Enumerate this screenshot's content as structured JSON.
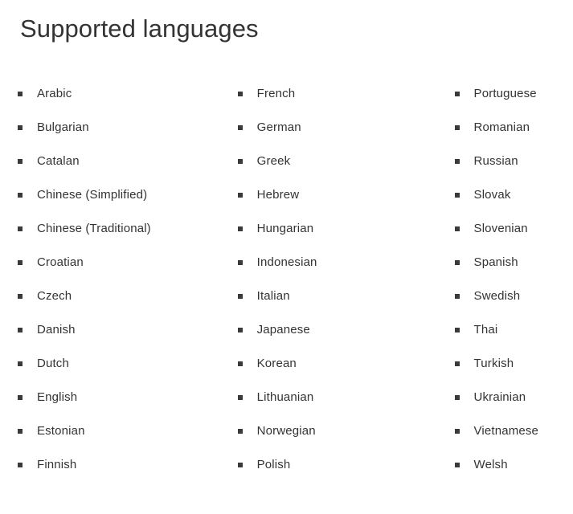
{
  "page": {
    "title": "Supported languages",
    "background_color": "#ffffff",
    "text_color": "#333333",
    "bullet_color": "#3a3a3a",
    "bullet_icon": "square-bullet-icon"
  },
  "columns": [
    {
      "name": "languages-column-1",
      "items": [
        {
          "label": "Arabic"
        },
        {
          "label": "Bulgarian"
        },
        {
          "label": "Catalan"
        },
        {
          "label": "Chinese (Simplified)"
        },
        {
          "label": "Chinese (Traditional)"
        },
        {
          "label": "Croatian"
        },
        {
          "label": "Czech"
        },
        {
          "label": "Danish"
        },
        {
          "label": "Dutch"
        },
        {
          "label": "English"
        },
        {
          "label": "Estonian"
        },
        {
          "label": "Finnish"
        }
      ]
    },
    {
      "name": "languages-column-2",
      "items": [
        {
          "label": "French"
        },
        {
          "label": "German"
        },
        {
          "label": "Greek"
        },
        {
          "label": "Hebrew"
        },
        {
          "label": "Hungarian"
        },
        {
          "label": "Indonesian"
        },
        {
          "label": "Italian"
        },
        {
          "label": "Japanese"
        },
        {
          "label": "Korean"
        },
        {
          "label": "Lithuanian"
        },
        {
          "label": "Norwegian"
        },
        {
          "label": "Polish"
        }
      ]
    },
    {
      "name": "languages-column-3",
      "items": [
        {
          "label": "Portuguese"
        },
        {
          "label": "Romanian"
        },
        {
          "label": "Russian"
        },
        {
          "label": "Slovak"
        },
        {
          "label": "Slovenian"
        },
        {
          "label": "Spanish"
        },
        {
          "label": "Swedish"
        },
        {
          "label": "Thai"
        },
        {
          "label": "Turkish"
        },
        {
          "label": "Ukrainian"
        },
        {
          "label": "Vietnamese"
        },
        {
          "label": "Welsh"
        }
      ]
    }
  ]
}
